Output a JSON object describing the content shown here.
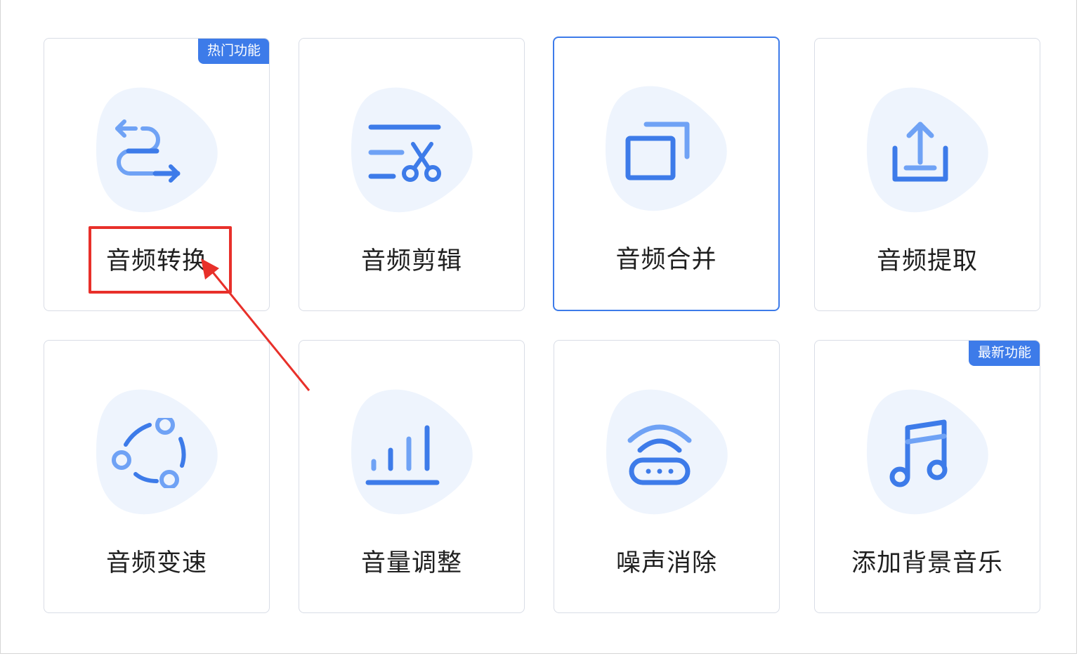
{
  "features": [
    {
      "label": "音频转换",
      "icon": "convert-arrows-icon",
      "badge": "热门功能"
    },
    {
      "label": "音频剪辑",
      "icon": "scissors-icon",
      "badge": ""
    },
    {
      "label": "音频合并",
      "icon": "merge-windows-icon",
      "badge": "",
      "active": true
    },
    {
      "label": "音频提取",
      "icon": "export-upload-icon",
      "badge": ""
    },
    {
      "label": "音频变速",
      "icon": "cycle-speed-icon",
      "badge": ""
    },
    {
      "label": "音量调整",
      "icon": "volume-bars-icon",
      "badge": ""
    },
    {
      "label": "噪声消除",
      "icon": "noise-router-icon",
      "badge": ""
    },
    {
      "label": "添加背景音乐",
      "icon": "music-note-icon",
      "badge": "最新功能"
    }
  ],
  "colors": {
    "accent": "#3d7be9",
    "icon_light": "#6fa2f5",
    "blob": "#eef4fd",
    "annotation": "#e8302a"
  }
}
